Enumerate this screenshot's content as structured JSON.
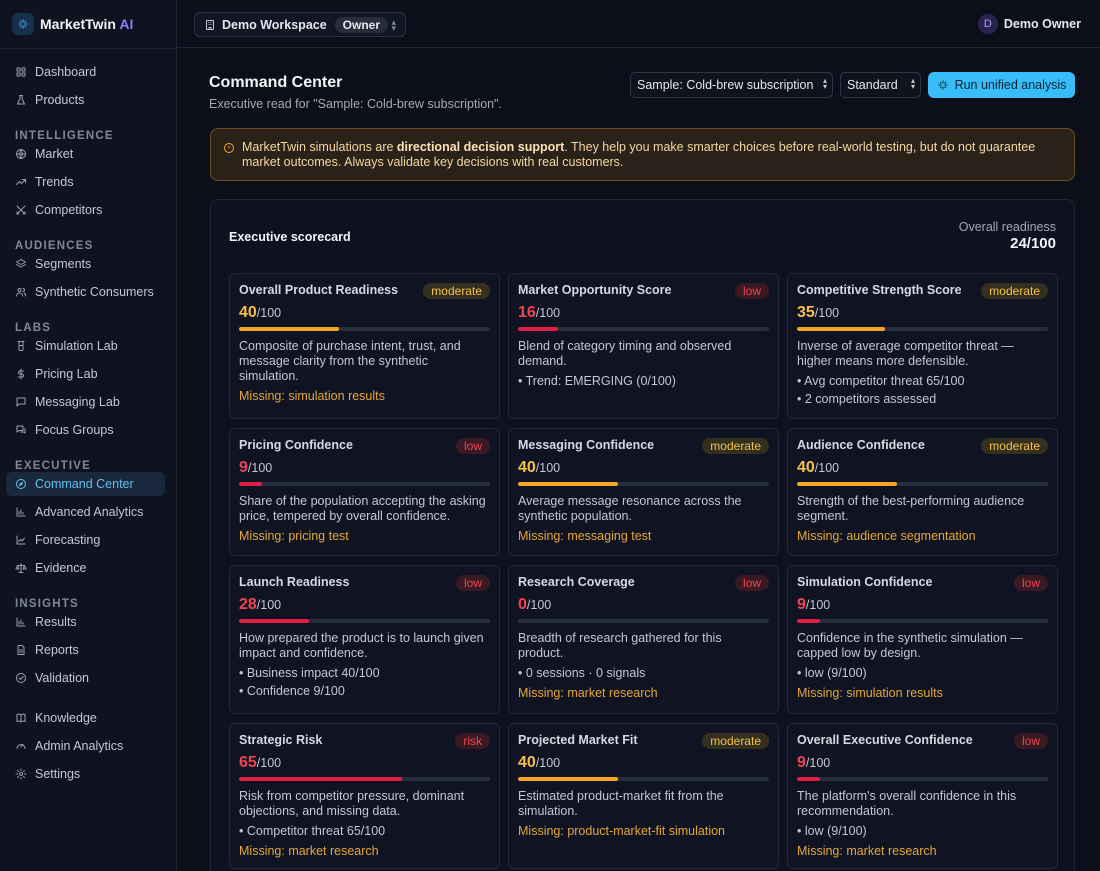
{
  "brand": {
    "name": "MarketTwin",
    "suffix": "AI"
  },
  "topbar": {
    "workspace": "Demo Workspace",
    "role": "Owner",
    "user_initial": "D",
    "user_name": "Demo Owner"
  },
  "sidebar": {
    "items": [
      {
        "label": "Dashboard",
        "icon": "grid-icon"
      },
      {
        "label": "Products",
        "icon": "flask-icon"
      },
      {
        "section": "INTELLIGENCE"
      },
      {
        "label": "Market",
        "icon": "globe-icon"
      },
      {
        "label": "Trends",
        "icon": "trend-icon"
      },
      {
        "label": "Competitors",
        "icon": "swords-icon"
      },
      {
        "section": "AUDIENCES"
      },
      {
        "label": "Segments",
        "icon": "layers-icon"
      },
      {
        "label": "Synthetic Consumers",
        "icon": "users-icon"
      },
      {
        "section": "LABS"
      },
      {
        "label": "Simulation Lab",
        "icon": "beaker-icon"
      },
      {
        "label": "Pricing Lab",
        "icon": "dollar-icon"
      },
      {
        "label": "Messaging Lab",
        "icon": "message-icon"
      },
      {
        "label": "Focus Groups",
        "icon": "chat-icon"
      },
      {
        "section": "EXECUTIVE"
      },
      {
        "label": "Command Center",
        "icon": "compass-icon",
        "active": true
      },
      {
        "label": "Advanced Analytics",
        "icon": "bar-chart-icon"
      },
      {
        "label": "Forecasting",
        "icon": "line-chart-icon"
      },
      {
        "label": "Evidence",
        "icon": "scale-icon"
      },
      {
        "section": "INSIGHTS"
      },
      {
        "label": "Results",
        "icon": "bar-chart-icon"
      },
      {
        "label": "Reports",
        "icon": "file-icon"
      },
      {
        "label": "Validation",
        "icon": "check-circle-icon"
      },
      {
        "label": "Knowledge",
        "icon": "book-icon"
      },
      {
        "label": "Admin Analytics",
        "icon": "gauge-icon"
      },
      {
        "label": "Settings",
        "icon": "gear-icon"
      }
    ]
  },
  "header": {
    "title": "Command Center",
    "subtitle": "Executive read for \"Sample: Cold-brew subscription\".",
    "product_select": "Sample: Cold-brew subscription",
    "mode_select": "Standard",
    "run_button": "Run unified analysis"
  },
  "banner": {
    "pre": "MarketTwin simulations are ",
    "strong": "directional decision support",
    "post": ". They help you make smarter choices before real-world testing, but do not guarantee market outcomes. Always validate key decisions with real customers."
  },
  "scorecard": {
    "title": "Executive scorecard",
    "overall_label": "Overall readiness",
    "overall_value": "24/100",
    "denominator": "/100",
    "cards": [
      {
        "title": "Overall Product Readiness",
        "level": "moderate",
        "score": 40,
        "desc": "Composite of purchase intent, trust, and message clarity from the synthetic simulation.",
        "bullets": [],
        "missing": "Missing: simulation results"
      },
      {
        "title": "Market Opportunity Score",
        "level": "low",
        "score": 16,
        "desc": "Blend of category timing and observed demand.",
        "bullets": [
          "• Trend: EMERGING (0/100)"
        ],
        "missing": ""
      },
      {
        "title": "Competitive Strength Score",
        "level": "moderate",
        "score": 35,
        "desc": "Inverse of average competitor threat — higher means more defensible.",
        "bullets": [
          "• Avg competitor threat 65/100",
          "• 2 competitors assessed"
        ],
        "missing": ""
      },
      {
        "title": "Pricing Confidence",
        "level": "low",
        "score": 9,
        "desc": "Share of the population accepting the asking price, tempered by overall confidence.",
        "bullets": [],
        "missing": "Missing: pricing test"
      },
      {
        "title": "Messaging Confidence",
        "level": "moderate",
        "score": 40,
        "desc": "Average message resonance across the synthetic population.",
        "bullets": [],
        "missing": "Missing: messaging test"
      },
      {
        "title": "Audience Confidence",
        "level": "moderate",
        "score": 40,
        "desc": "Strength of the best-performing audience segment.",
        "bullets": [],
        "missing": "Missing: audience segmentation"
      },
      {
        "title": "Launch Readiness",
        "level": "low",
        "score": 28,
        "desc": "How prepared the product is to launch given impact and confidence.",
        "bullets": [
          "• Business impact 40/100",
          "• Confidence 9/100"
        ],
        "missing": ""
      },
      {
        "title": "Research Coverage",
        "level": "low",
        "score": 0,
        "desc": "Breadth of research gathered for this product.",
        "bullets": [
          "• 0 sessions · 0 signals"
        ],
        "missing": "Missing: market research"
      },
      {
        "title": "Simulation Confidence",
        "level": "low",
        "score": 9,
        "desc": "Confidence in the synthetic simulation — capped low by design.",
        "bullets": [
          "• low (9/100)"
        ],
        "missing": "Missing: simulation results"
      },
      {
        "title": "Strategic Risk",
        "level": "risk",
        "score": 65,
        "desc": "Risk from competitor pressure, dominant objections, and missing data.",
        "bullets": [
          "• Competitor threat 65/100"
        ],
        "missing": "Missing: market research"
      },
      {
        "title": "Projected Market Fit",
        "level": "moderate",
        "score": 40,
        "desc": "Estimated product-market fit from the simulation.",
        "bullets": [],
        "missing": "Missing: product-market-fit simulation"
      },
      {
        "title": "Overall Executive Confidence",
        "level": "low",
        "score": 9,
        "desc": "The platform's overall confidence in this recommendation.",
        "bullets": [
          "• low (9/100)"
        ],
        "missing": "Missing: market research"
      }
    ]
  },
  "colors": {
    "accent": "#38bdf8",
    "moderate": "#f7c04a",
    "low": "#ef4451",
    "missing": "#e5a83a"
  }
}
